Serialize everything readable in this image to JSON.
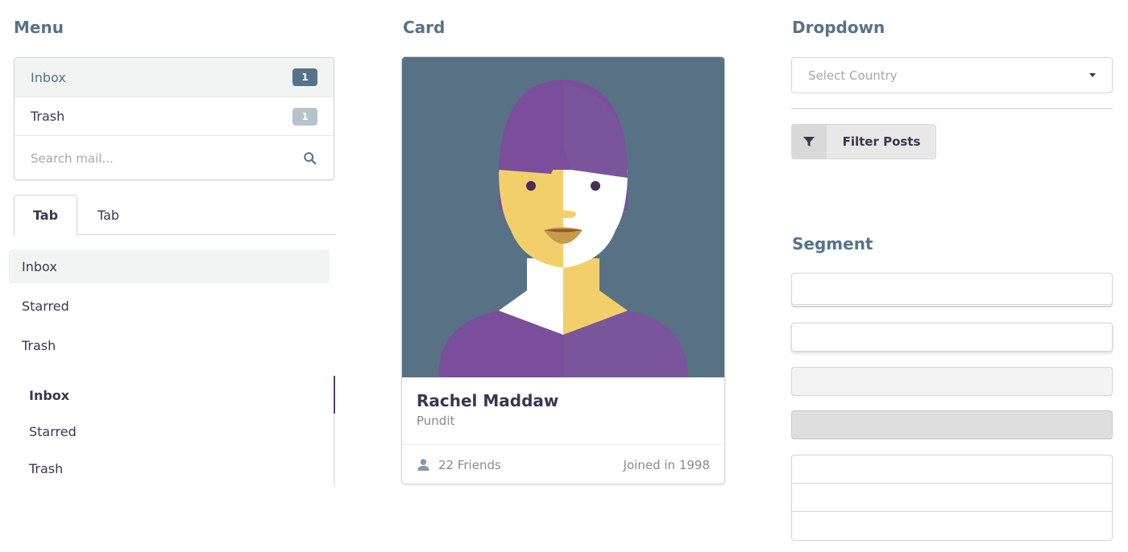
{
  "headings": {
    "menu": "Menu",
    "card": "Card",
    "dropdown": "Dropdown",
    "segment": "Segment"
  },
  "menu": {
    "items": [
      {
        "label": "Inbox",
        "count": "1"
      },
      {
        "label": "Trash",
        "count": "1"
      }
    ],
    "search_placeholder": "Search mail...",
    "search_icon": "search-icon"
  },
  "tabs": [
    {
      "label": "Tab",
      "active": true
    },
    {
      "label": "Tab",
      "active": false
    }
  ],
  "vertical_menu": [
    {
      "label": "Inbox",
      "active": true
    },
    {
      "label": "Starred",
      "active": false
    },
    {
      "label": "Trash",
      "active": false
    }
  ],
  "pointing_menu": [
    {
      "label": "Inbox",
      "active": true
    },
    {
      "label": "Starred",
      "active": false
    },
    {
      "label": "Trash",
      "active": false
    }
  ],
  "card": {
    "name": "Rachel Maddaw",
    "meta": "Pundit",
    "friends": "22 Friends",
    "joined": "Joined in 1998",
    "friends_icon": "user-icon"
  },
  "dropdown": {
    "placeholder": "Select Country"
  },
  "filter_button": {
    "label": "Filter Posts",
    "icon": "filter-icon"
  },
  "colors": {
    "heading": "#56738a",
    "badge_primary": "#56738a",
    "badge_secondary": "#b5c3cb",
    "card_image_bg": "#587185",
    "active_border": "#5b3c6b"
  }
}
